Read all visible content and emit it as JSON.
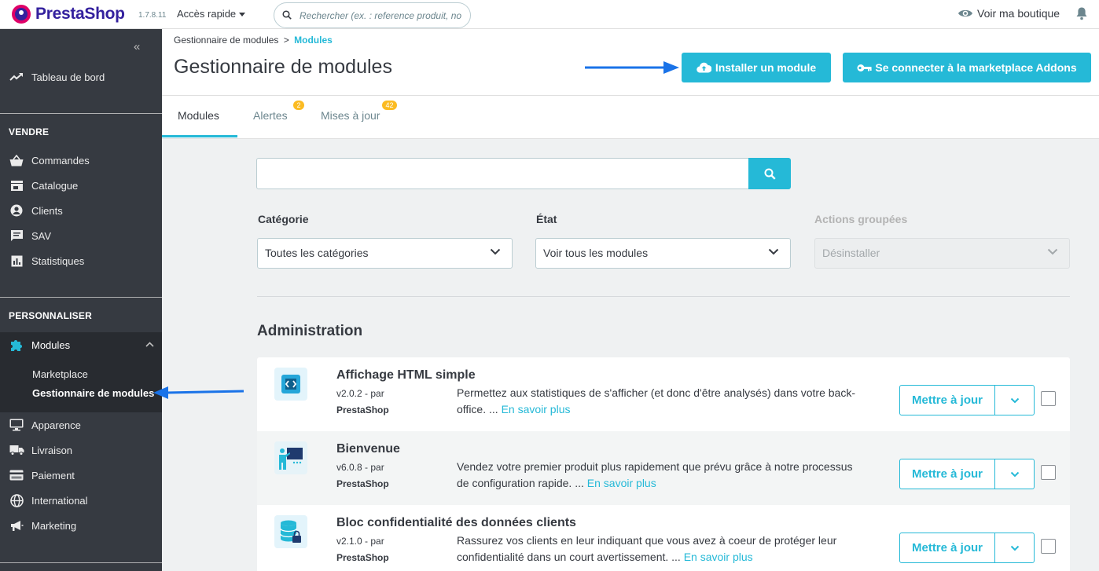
{
  "header": {
    "logo_text": "PrestaShop",
    "version": "1.7.8.11",
    "quick_access": "Accès rapide",
    "search_placeholder": "Rechercher (ex. : reference produit, no",
    "view_shop": "Voir ma boutique"
  },
  "sidebar": {
    "dashboard": "Tableau de bord",
    "sections": [
      {
        "title": "VENDRE",
        "items": [
          "Commandes",
          "Catalogue",
          "Clients",
          "SAV",
          "Statistiques"
        ]
      },
      {
        "title": "PERSONNALISER",
        "items": [
          "Modules",
          "Apparence",
          "Livraison",
          "Paiement",
          "International",
          "Marketing"
        ]
      }
    ],
    "modules_submenu": [
      "Marketplace",
      "Gestionnaire de modules"
    ]
  },
  "breadcrumb": {
    "parent": "Gestionnaire de modules",
    "separator": ">",
    "current": "Modules"
  },
  "page_title": "Gestionnaire de modules",
  "toolbar": {
    "install_label": "Installer un module",
    "connect_label": "Se connecter à la marketplace Addons"
  },
  "tabs": [
    {
      "label": "Modules",
      "badge": ""
    },
    {
      "label": "Alertes",
      "badge": "2"
    },
    {
      "label": "Mises à jour",
      "badge": "42"
    }
  ],
  "filters": {
    "category_label": "Catégorie",
    "category_value": "Toutes les catégories",
    "state_label": "État",
    "state_value": "Voir tous les modules",
    "bulk_label": "Actions groupées",
    "bulk_value": "Désinstaller"
  },
  "section_title": "Administration",
  "modules": [
    {
      "name": "Affichage HTML simple",
      "version": "v2.0.2 - par",
      "author": "PrestaShop",
      "description": "Permettez aux statistiques de s'afficher (et donc d'être analysés) dans votre back-office. ...",
      "more": "En savoir plus",
      "action": "Mettre à jour"
    },
    {
      "name": "Bienvenue",
      "version": "v6.0.8 - par",
      "author": "PrestaShop",
      "description": "Vendez votre premier produit plus rapidement que prévu grâce à notre processus de configuration rapide. ...",
      "more": "En savoir plus",
      "action": "Mettre à jour"
    },
    {
      "name": "Bloc confidentialité des données clients",
      "version": "v2.1.0 - par",
      "author": "PrestaShop",
      "description": "Rassurez vos clients en leur indiquant que vous avez à coeur de protéger leur confidentialité dans un court avertissement. ...",
      "more": "En savoir plus",
      "action": "Mettre à jour"
    }
  ],
  "colors": {
    "primary": "#25b9d7",
    "sidebar_bg": "#363a41",
    "badge": "#fbbb22",
    "annotation_arrow": "#1a73e8"
  }
}
